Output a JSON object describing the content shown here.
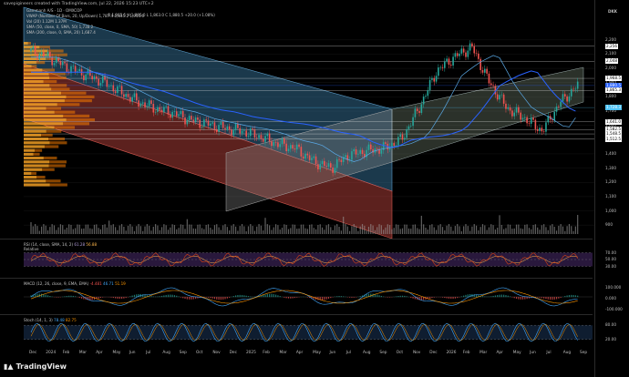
{
  "header": "savepigineers created with TradingView.com, Jul 22, 2026 15:23 UTC+2",
  "legend": {
    "symbol": "Gammanh A/S · 1D · OMXCOP",
    "ohlc": "O 1,865.5 H 1,895.0 L 1,863.0 C 1,880.5 +20.0 (+1.08%)",
    "vwap": "VWAP (Number Of Bars, 20, Up/Down) 1,787.4 1,845.2 1,913.6",
    "vol": "Vol (20) 1.12M 1.37M",
    "sma": "SMA (50, close, 0, SMA, 50) 1,738.2",
    "sma2": "SMA (200, close, 0, SMA, 20) 1,687.4"
  },
  "panes": {
    "rsi": {
      "label": "RSI (14, close, SMA, 14, 2)",
      "v1": "61.28",
      "v2": "56.88",
      "sub": "Relative"
    },
    "macd": {
      "label": "MACD (12, 26, close, 9, EMA, EMA)",
      "v1": "-4.481",
      "v2": "46.71",
      "v3": "51.19"
    },
    "stoch": {
      "label": "Stoch (14, 1, 3)",
      "v1": "78.48",
      "v2": "82.75"
    }
  },
  "axis_unit": "DKK",
  "footer": {
    "brand": "TradingView"
  },
  "colors": {
    "up": "#26a69a",
    "down": "#ef5350",
    "sma50": "#5aa9e6",
    "sma200": "#2962ff",
    "bluechannel": "#3c7ea8",
    "redchannel": "#b7423b",
    "greychannel": "#8a8a8a",
    "greenchannel": "#7a8c78"
  },
  "chart_data": {
    "type": "candlestick",
    "price_axis": {
      "ticks": [
        "2,200",
        "2,100",
        "2,000",
        "1,900",
        "1,800",
        "1,700",
        "1,600",
        "1,500",
        "1,400",
        "1,300",
        "1,200",
        "1,100",
        "1,000",
        "900"
      ],
      "range": [
        850,
        2250
      ]
    },
    "price_tags": [
      {
        "value": "2,256",
        "y_value": 2156,
        "color": "#ffffff"
      },
      {
        "value": "2,048",
        "y_value": 2050,
        "color": "#ffffff"
      },
      {
        "value": "1,968.5",
        "y_value": 1930,
        "color": "#ffffff"
      },
      {
        "value": "1,880.5",
        "y_value": 1880,
        "color": "#2962ff"
      },
      {
        "value": "1,865.3",
        "y_value": 1845,
        "color": "#ffffff"
      },
      {
        "value": "1,728.3",
        "y_value": 1725,
        "color": "#4fc3f7"
      },
      {
        "value": "1,641.0",
        "y_value": 1625,
        "color": "#ffffff"
      },
      {
        "value": "1,582.5",
        "y_value": 1570,
        "color": "#ffffff"
      },
      {
        "value": "1,548.5",
        "y_value": 1540,
        "color": "#ffffff"
      },
      {
        "value": "1,512.5",
        "y_value": 1505,
        "color": "#ffffff"
      }
    ],
    "time_axis": [
      "Dec",
      "2024",
      "Feb",
      "Mar",
      "Apr",
      "May",
      "Jun",
      "Jul",
      "Aug",
      "Sep",
      "Oct",
      "Nov",
      "Dec",
      "2025",
      "Feb",
      "Mar",
      "Apr",
      "May",
      "Jun",
      "Jul",
      "Aug",
      "Sep",
      "Oct",
      "Nov",
      "Dec",
      "2026",
      "Feb",
      "Mar",
      "Apr",
      "May",
      "Jun",
      "Jul",
      "Aug",
      "Sep"
    ],
    "close_path_months": [
      "Dec",
      "2024",
      "Feb",
      "Mar",
      "Apr",
      "May",
      "Jun",
      "Jul",
      "Aug",
      "Sep",
      "Oct",
      "Nov",
      "Dec",
      "2025",
      "Feb",
      "Mar",
      "Apr",
      "May",
      "Jun",
      "Jul",
      "Aug",
      "Sep",
      "Oct",
      "Nov",
      "Dec",
      "2026",
      "Feb",
      "Mar",
      "Apr",
      "May",
      "Jun",
      "Jul"
    ],
    "close_path": [
      2120,
      2080,
      2010,
      1960,
      1910,
      1840,
      1770,
      1720,
      1690,
      1640,
      1610,
      1580,
      1560,
      1520,
      1470,
      1440,
      1350,
      1300,
      1390,
      1420,
      1440,
      1500,
      1720,
      1980,
      2080,
      2150,
      1900,
      1720,
      1650,
      1560,
      1760,
      1880
    ],
    "rsi_levels": [
      70,
      50,
      30
    ],
    "macd_ticks": [
      "100.000",
      "0.000",
      "-100.000"
    ],
    "stoch_ticks": [
      "80.00",
      "20.00"
    ]
  }
}
